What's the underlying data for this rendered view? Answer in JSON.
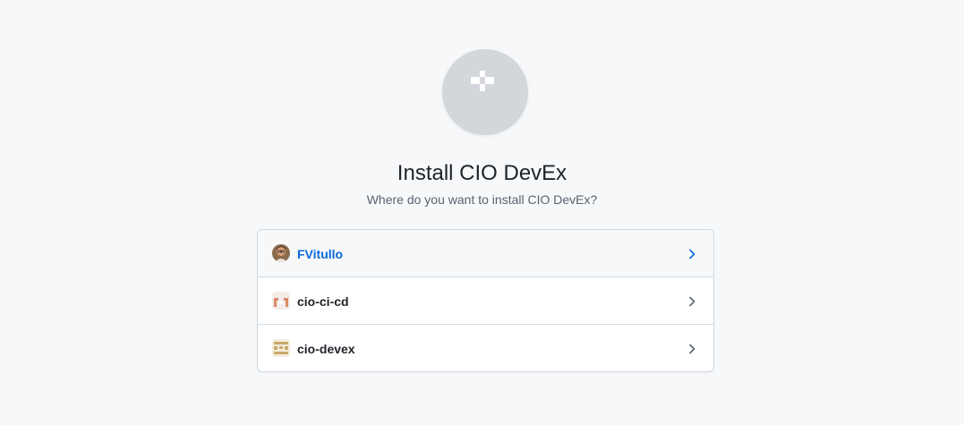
{
  "page": {
    "title": "Install CIO DevEx",
    "subtitle": "Where do you want to install CIO DevEx?"
  },
  "app_logo": {
    "icon": "app-identicon-icon",
    "background": "#d3d6db",
    "glyph_color": "#ffffff"
  },
  "accounts": [
    {
      "name": "FVitullo",
      "avatar": "user-avatar",
      "highlighted": true
    },
    {
      "name": "cio-ci-cd",
      "avatar": "org-identicon-orange"
    },
    {
      "name": "cio-devex",
      "avatar": "org-identicon-tan"
    }
  ],
  "colors": {
    "accent": "#0969da",
    "text": "#1f2328",
    "muted": "#59636e",
    "border": "#d1d9e0",
    "page_bg": "#f6f8fa"
  },
  "icons": {
    "row_chevron": "chevron-right-icon"
  }
}
